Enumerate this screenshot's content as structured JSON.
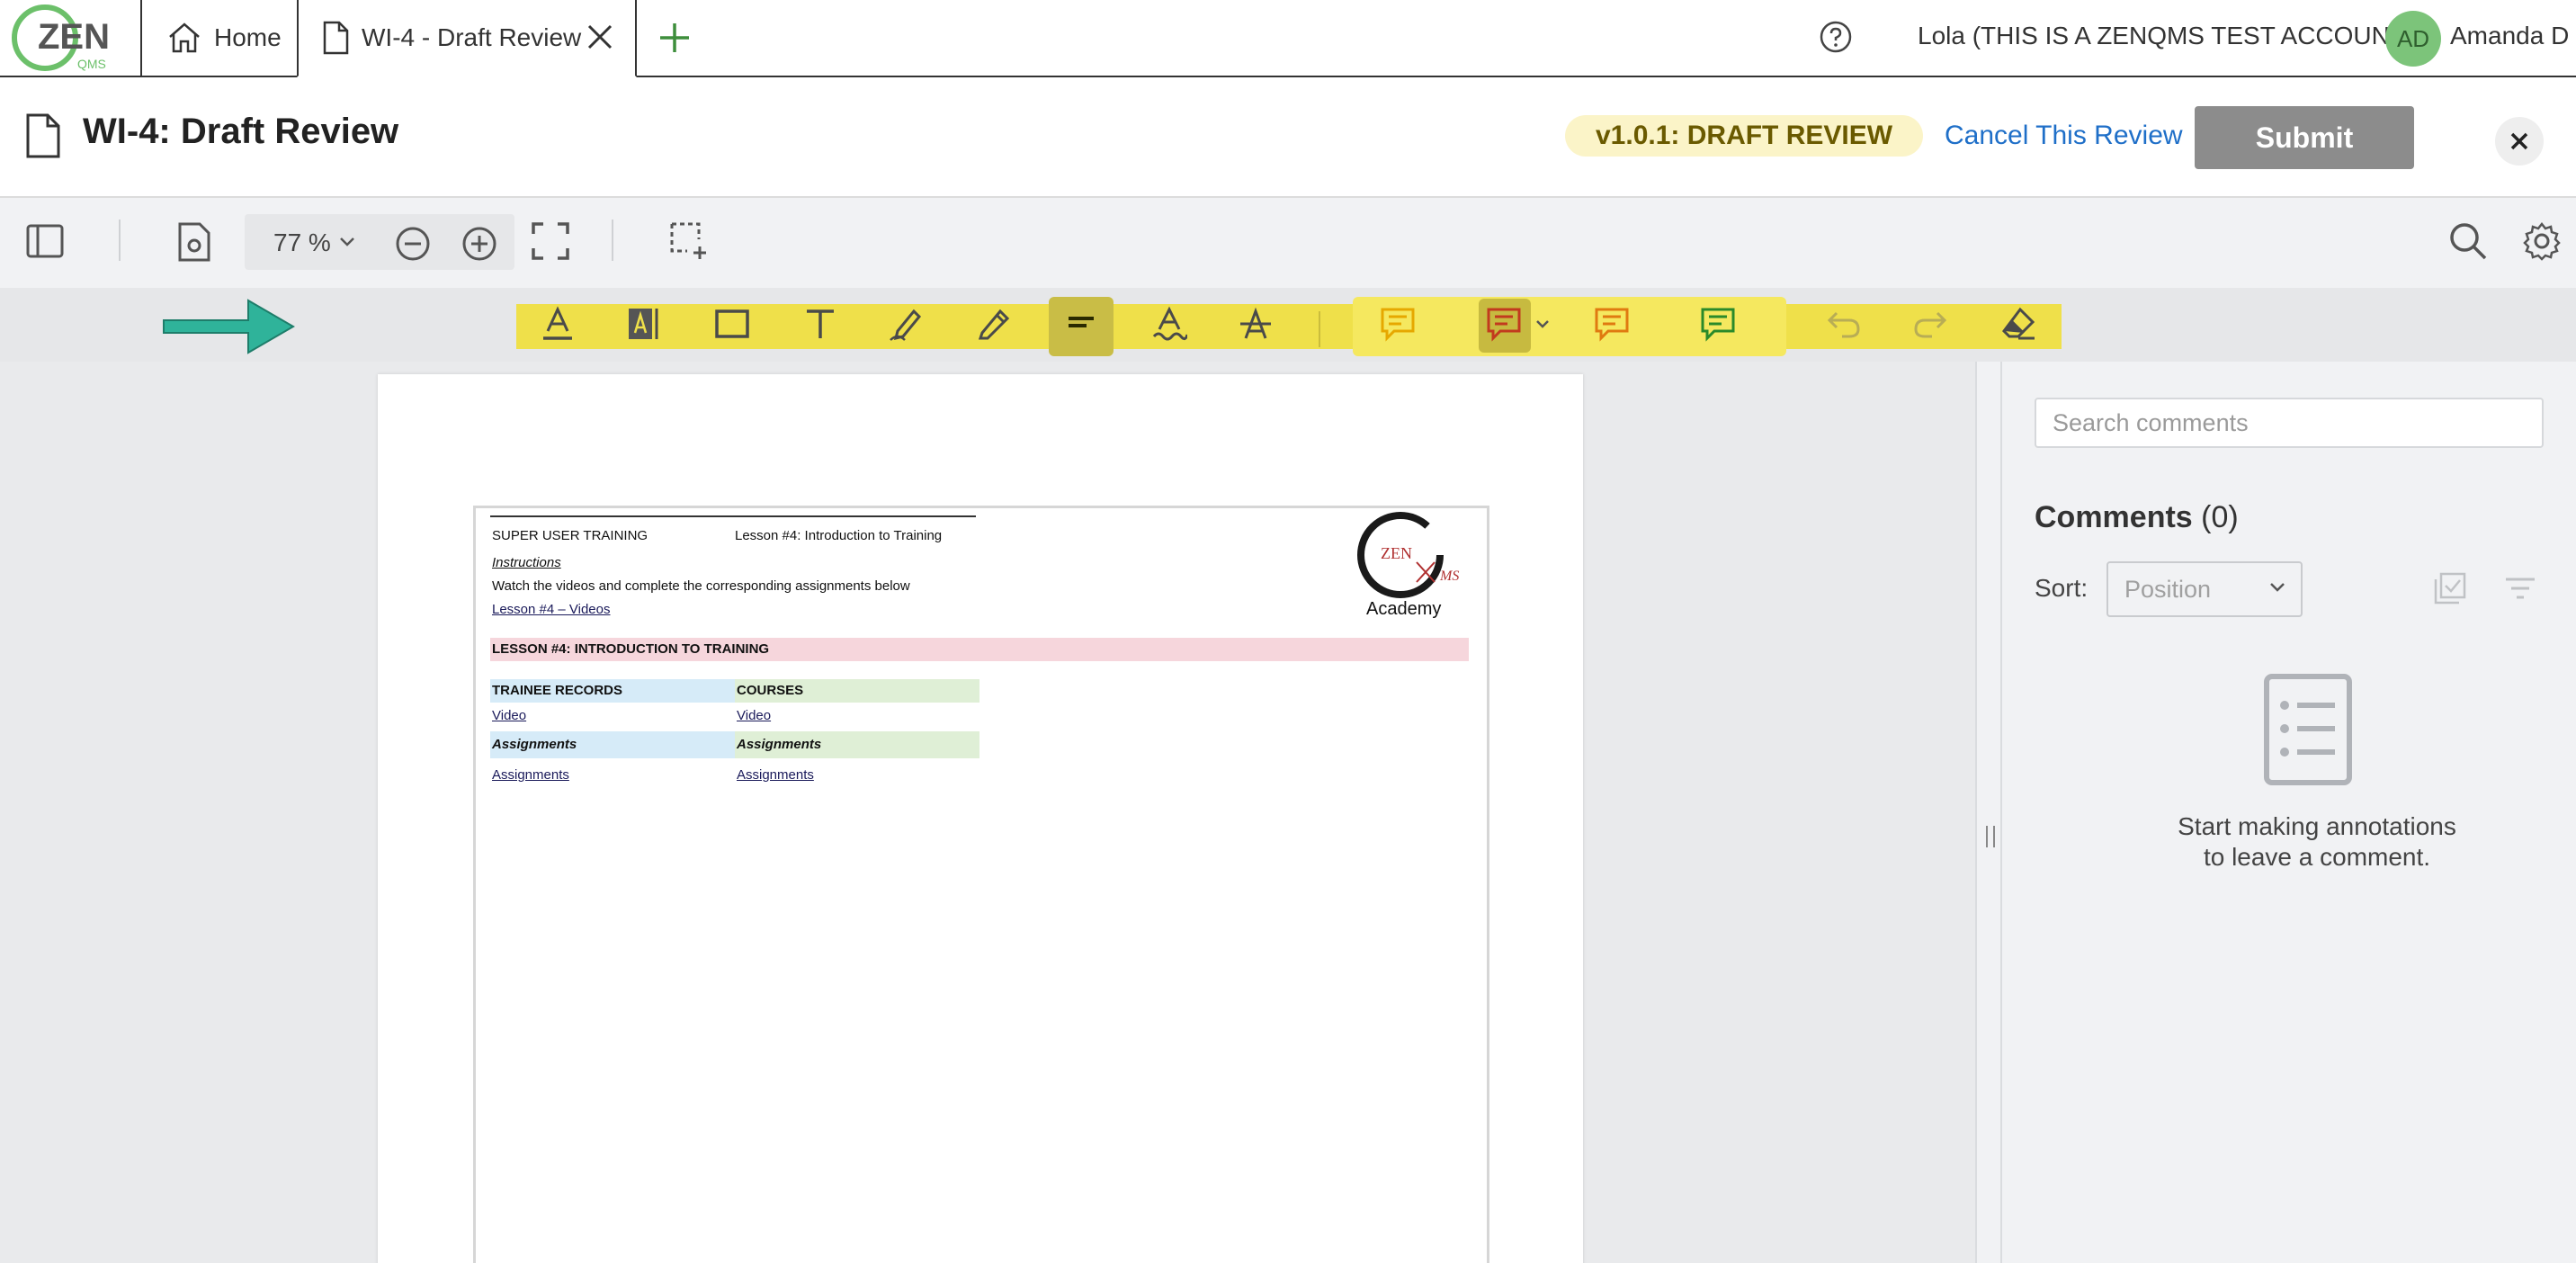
{
  "colors": {
    "accent": "#1f6fc8",
    "badge_bg": "#fbf4c8",
    "annotation_bar": "#efe04a",
    "submit_disabled": "#8c8c8c",
    "avatar_bg": "#7cc47a"
  },
  "app": {
    "logo_text": "ZEN",
    "logo_sub": "QMS"
  },
  "tabs": [
    {
      "label": "Home",
      "icon": "home-icon"
    },
    {
      "label": "WI-4 - Draft Review",
      "icon": "document-icon"
    }
  ],
  "header": {
    "account": "Lola (THIS IS A ZENQMS TEST ACCOUNT)",
    "avatar_initials": "AD",
    "user_name": "Amanda D"
  },
  "titlebar": {
    "title": "WI-4: Draft Review",
    "version_badge": "v1.0.1: DRAFT REVIEW",
    "cancel_label": "Cancel This Review",
    "submit_label": "Submit"
  },
  "viewer": {
    "zoom": "77 %"
  },
  "document": {
    "header_left": "SUPER USER TRAINING",
    "header_right": "Lesson #4: Introduction to Training",
    "instructions_label": "Instructions",
    "instructions_text": "Watch the videos and complete the corresponding assignments below",
    "videos_link": "Lesson #4 – Videos",
    "logo_zen": "ZEN",
    "logo_ms": "MS",
    "logo_academy": "Academy",
    "section_title": "LESSON #4: INTRODUCTION TO TRAINING",
    "col1_title": "TRAINEE RECORDS",
    "col2_title": "COURSES",
    "col1_video": "Video",
    "col2_video": "Video",
    "col1_assign_header": "Assignments",
    "col2_assign_header": "Assignments",
    "col1_assign_link": "Assignments",
    "col2_assign_link": "Assignments"
  },
  "comments": {
    "search_placeholder": "Search comments",
    "title": "Comments",
    "count": "(0)",
    "sort_label": "Sort:",
    "sort_value": "Position",
    "empty_line1": "Start making annotations",
    "empty_line2": "to leave a comment."
  }
}
